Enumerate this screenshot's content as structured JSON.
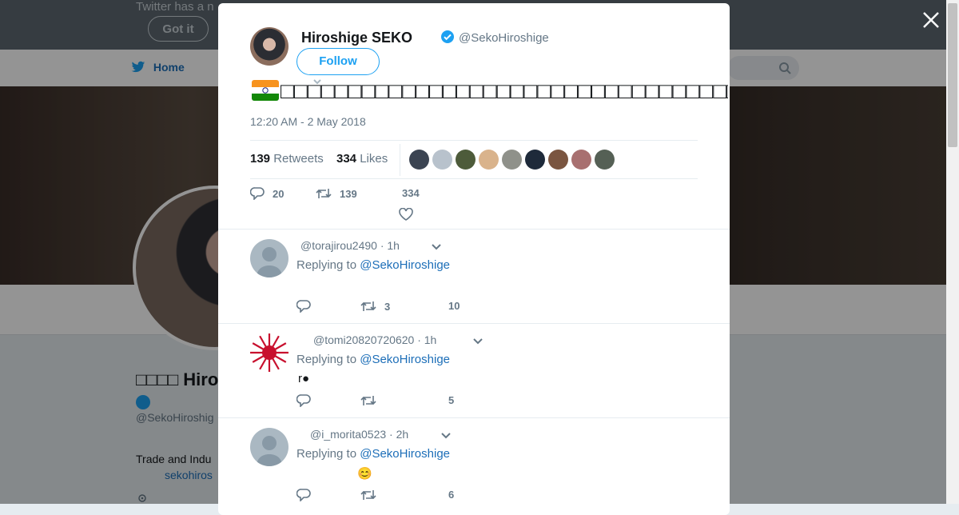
{
  "background": {
    "banner_text": "Twitter has a n",
    "got_it_label": "Got it",
    "nav_home_label": "Home",
    "profile_name": "□□□□ Hiro",
    "profile_handle": "@SekoHiroshig",
    "bio": "Trade and Indu",
    "link": "sekohiros"
  },
  "tweet": {
    "author_name": "Hiroshige SEKO",
    "author_handle": "@SekoHiroshige",
    "follow_label": "Follow",
    "text": "□□□□□□□□□□□□□□□□□□□□□□□□□□□□□□□□□□□□□□□□□□□□",
    "timestamp": "12:20 AM - 2 May 2018",
    "retweets_count": "139",
    "retweets_label": "Retweets",
    "likes_count": "334",
    "likes_label": "Likes",
    "reply_count": "20",
    "retweet_action_count": "139",
    "like_action_count": "334"
  },
  "liker_colors": [
    "#3b4452",
    "#b8c2cc",
    "#4d5b3a",
    "#d9b38c",
    "#8f918a",
    "#1e2a3a",
    "#7a5540",
    "#a87070",
    "#556055"
  ],
  "replies": [
    {
      "handle": "@torajirou2490",
      "time": "· 1h",
      "replying_prefix": "Replying to",
      "replying_to": "@SekoHiroshige",
      "body": "",
      "reply_count": "",
      "retweet_count": "3",
      "like_count": "10",
      "avatar_color": "#aab8c2"
    },
    {
      "handle": "@tomi20820720620",
      "time": "· 1h",
      "replying_prefix": "Replying to",
      "replying_to": "@SekoHiroshige",
      "body": "r●",
      "reply_count": "",
      "retweet_count": "",
      "like_count": "5",
      "avatar_color": "#c8102e"
    },
    {
      "handle": "@i_morita0523",
      "time": "· 2h",
      "replying_prefix": "Replying to",
      "replying_to": "@SekoHiroshige",
      "body": "😊",
      "reply_count": "",
      "retweet_count": "",
      "like_count": "6",
      "avatar_color": "#aab8c2"
    }
  ]
}
